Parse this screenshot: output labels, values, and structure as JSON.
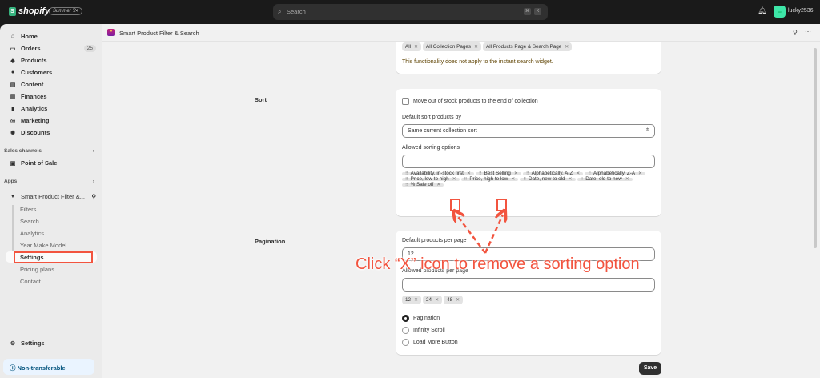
{
  "topbar": {
    "brand": "shopify",
    "edition": "Summer '24",
    "search_placeholder": "Search",
    "kbd": [
      "⌘",
      "K"
    ],
    "avatar_initials": "luc",
    "username": "lucky2536"
  },
  "sidebar": {
    "items": [
      {
        "label": "Home",
        "icon": "home-icon"
      },
      {
        "label": "Orders",
        "icon": "inbox-icon",
        "count": "25"
      },
      {
        "label": "Products",
        "icon": "tag-icon"
      },
      {
        "label": "Customers",
        "icon": "person-icon"
      },
      {
        "label": "Content",
        "icon": "content-icon"
      },
      {
        "label": "Finances",
        "icon": "bank-icon"
      },
      {
        "label": "Analytics",
        "icon": "chart-icon"
      },
      {
        "label": "Marketing",
        "icon": "target-icon"
      },
      {
        "label": "Discounts",
        "icon": "discount-icon"
      }
    ],
    "sales_channels": "Sales channels",
    "point_of_sale": "Point of Sale",
    "apps": "Apps",
    "app_name": "Smart Product Filter &...",
    "app_subitems": [
      "Filters",
      "Search",
      "Analytics",
      "Year Make Model",
      "Settings",
      "Pricing plans",
      "Contact"
    ],
    "settings": "Settings",
    "non_transferable": "Non-transferable"
  },
  "app": {
    "title": "Smart Product Filter & Search"
  },
  "pages_card": {
    "tags": [
      "All",
      "All Collection Pages",
      "All Products Page & Search Page"
    ],
    "note": "This functionality does not apply to the instant search widget.",
    "note_color": "#5e4200"
  },
  "sort": {
    "section": "Sort",
    "checkbox": "Move out of stock products to the end of collection",
    "default_label": "Default sort products by",
    "default_value": "Same current collection sort",
    "allowed_label": "Allowed sorting options",
    "allowed_value": "",
    "options": [
      "Availability, in-stock first",
      "Best Selling",
      "Alphabetically, A-Z",
      "Alphabetically, Z-A",
      "Price, low to high",
      "Price, high to low",
      "Date, new to old",
      "Date, old to new",
      "% Sale off"
    ]
  },
  "pagination": {
    "section": "Pagination",
    "default_label": "Default products per page",
    "default_value": "12",
    "allowed_label": "Allowed products per page",
    "allowed_value": "",
    "tags": [
      "12",
      "24",
      "48"
    ],
    "modes": [
      {
        "label": "Pagination",
        "selected": true
      },
      {
        "label": "Infinity Scroll",
        "selected": false
      },
      {
        "label": "Load More Button",
        "selected": false
      }
    ]
  },
  "save": "Save",
  "annotation": {
    "text": "Click “X” icon to remove a sorting option",
    "color": "#f2543f"
  }
}
